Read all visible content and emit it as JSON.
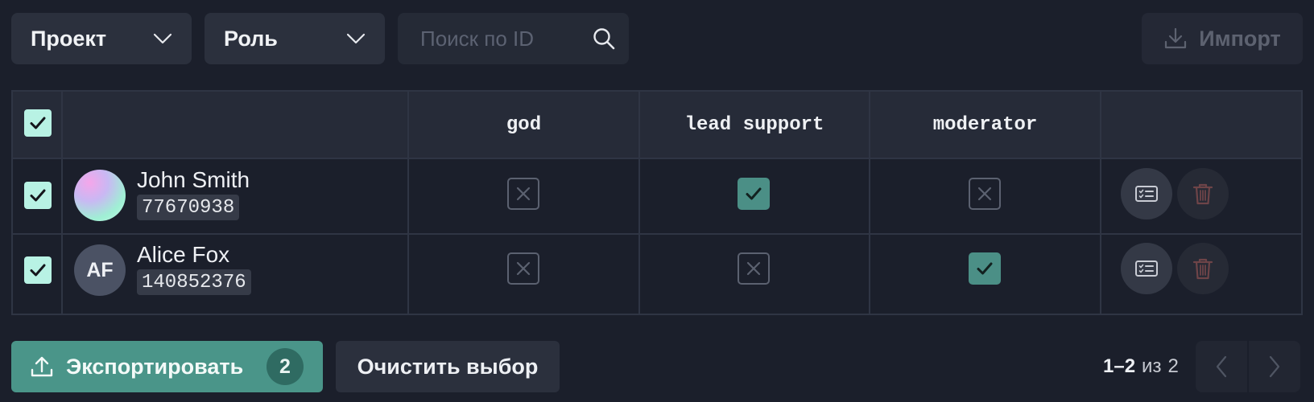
{
  "toolbar": {
    "project_label": "Проект",
    "role_label": "Роль",
    "search_placeholder": "Поиск по ID",
    "search_value": "",
    "import_label": "Импорт"
  },
  "table": {
    "header_checked": true,
    "role_columns": [
      "god",
      "lead support",
      "moderator"
    ],
    "rows": [
      {
        "name": "John Smith",
        "id": "77670938",
        "avatar": "gradient",
        "avatar_initials": "",
        "selected": true,
        "permissions": [
          false,
          true,
          false
        ]
      },
      {
        "name": "Alice Fox",
        "id": "140852376",
        "avatar": "initials",
        "avatar_initials": "AF",
        "selected": true,
        "permissions": [
          false,
          false,
          true
        ]
      }
    ]
  },
  "footer": {
    "export_label": "Экспортировать",
    "export_count": "2",
    "clear_label": "Очистить выбор",
    "page_range": "1–2",
    "page_of": "из",
    "page_total": "2"
  },
  "colors": {
    "accent": "#4a9589",
    "checkbox": "#b8f2e4",
    "permission_on": "#4b8f86",
    "background": "#1b1f2b"
  }
}
